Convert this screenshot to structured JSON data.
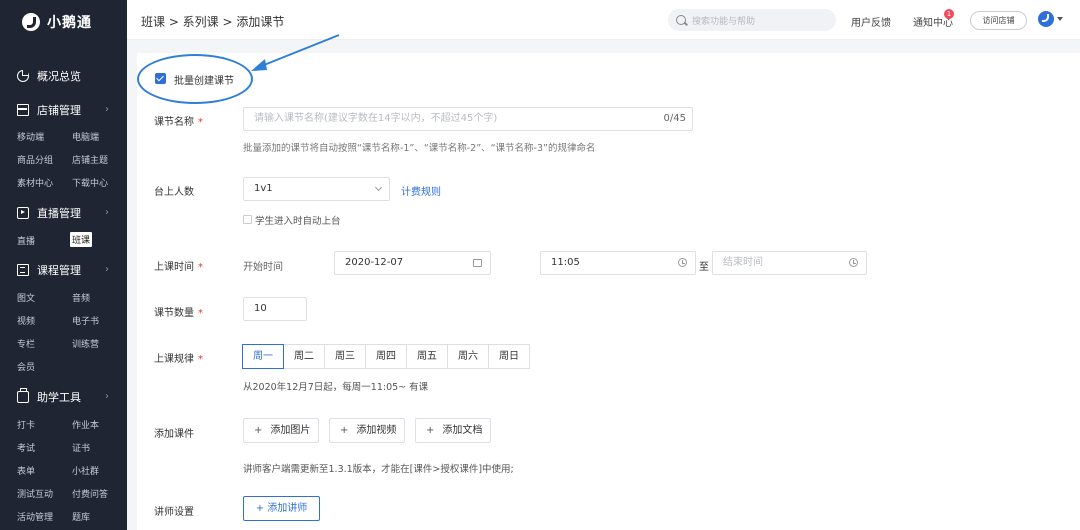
{
  "app": {
    "name": "小鹅通"
  },
  "sidebar": {
    "overview": "概况总览",
    "sections": [
      {
        "label": "店铺管理",
        "items": [
          "移动端",
          "电脑端",
          "商品分组",
          "店铺主题",
          "素材中心",
          "下载中心"
        ]
      },
      {
        "label": "直播管理",
        "items": [
          "直播",
          "班课"
        ],
        "active_item": "班课"
      },
      {
        "label": "课程管理",
        "items": [
          "图文",
          "音频",
          "视频",
          "电子书",
          "专栏",
          "训练营",
          "会员"
        ]
      },
      {
        "label": "助学工具",
        "items": [
          "打卡",
          "作业本",
          "考试",
          "证书",
          "表单",
          "小社群",
          "测试互动",
          "付费问答",
          "活动管理",
          "题库"
        ]
      }
    ]
  },
  "header": {
    "breadcrumb": "班课 > 系列课 > 添加课节",
    "search_placeholder": "搜索功能与帮助",
    "feedback": "用户反馈",
    "notifications": "通知中心",
    "notification_count": "1",
    "visit_shop": "访问店铺"
  },
  "form": {
    "batch_create_label": "批量创建课节",
    "batch_create_checked": true,
    "lesson_name": {
      "label": "课节名称",
      "placeholder": "请输入课节名称(建议字数在14字以内，不超过45个字)",
      "counter": "0/45",
      "hint": "批量添加的课节将自动按照“课节名称-1”、“课节名称-2”、“课节名称-3”的规律命名"
    },
    "stage_count": {
      "label": "台上人数",
      "value": "1v1",
      "pricing_link": "计费规则",
      "auto_stage_label": "学生进入时自动上台"
    },
    "class_time": {
      "label": "上课时间",
      "start_label": "开始时间",
      "date": "2020-12-07",
      "time": "11:05",
      "to": "至",
      "end_placeholder": "结束时间"
    },
    "lesson_count": {
      "label": "课节数量",
      "value": "10"
    },
    "schedule": {
      "label": "上课规律",
      "days": [
        "周一",
        "周二",
        "周三",
        "周四",
        "周五",
        "周六",
        "周日"
      ],
      "active_day": "周一",
      "summary": "从2020年12月7日起，每周一11:05~ 有课"
    },
    "courseware": {
      "label": "添加课件",
      "buttons": [
        "添加图片",
        "添加视频",
        "添加文档"
      ],
      "hint": "讲师客户端需更新至1.3.1版本，才能在[课件>授权课件]中使用;"
    },
    "teacher": {
      "label": "讲师设置",
      "button": "+ 添加讲师"
    }
  },
  "colors": {
    "accent": "#2f6fdc",
    "sidebar_bg": "#1f2533",
    "required": "#e03b3b",
    "annotation": "#2f7fd9"
  }
}
